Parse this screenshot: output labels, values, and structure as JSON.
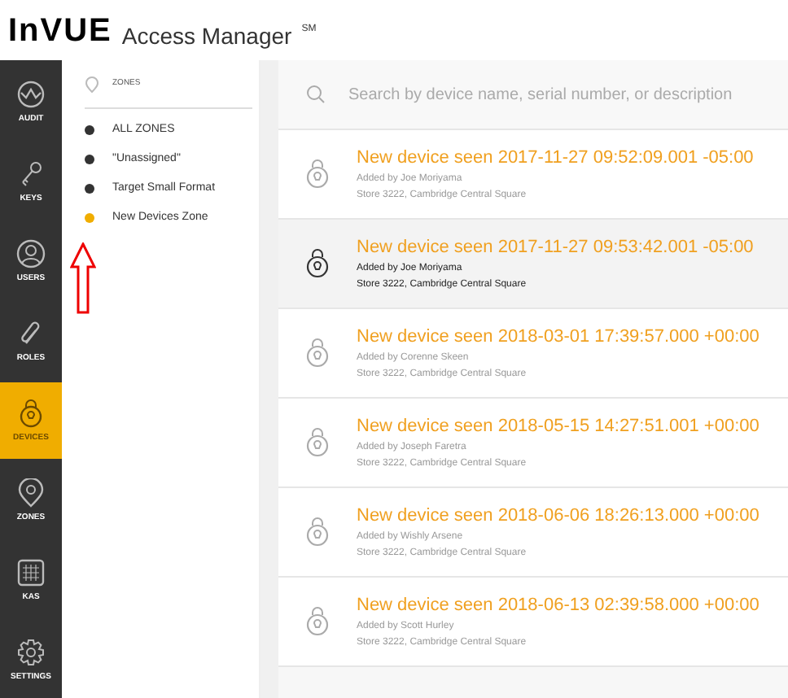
{
  "header": {
    "logo": "InVUE",
    "title": "Access Manager",
    "mark": "SM"
  },
  "nav": [
    {
      "label": "AUDIT",
      "selected": false
    },
    {
      "label": "KEYS",
      "selected": false
    },
    {
      "label": "USERS",
      "selected": false
    },
    {
      "label": "ROLES",
      "selected": false
    },
    {
      "label": "DEVICES",
      "selected": true
    },
    {
      "label": "ZONES",
      "selected": false
    },
    {
      "label": "KAS",
      "selected": false
    },
    {
      "label": "SETTINGS",
      "selected": false
    }
  ],
  "zones": {
    "title": "ZONES",
    "items": [
      {
        "label": "ALL ZONES",
        "color": "#333333"
      },
      {
        "label": "\"Unassigned\"",
        "color": "#333333"
      },
      {
        "label": "Target Small Format",
        "color": "#333333"
      },
      {
        "label": "New Devices Zone",
        "color": "#f0ad00"
      }
    ]
  },
  "search": {
    "placeholder": "Search by device name, serial number, or description"
  },
  "devices": [
    {
      "title": "New device seen 2017-11-27 09:52:09.001 -05:00",
      "added_by": "Added by Joe Moriyama",
      "location": "Store 3222, Cambridge Central Square",
      "selected": false
    },
    {
      "title": "New device seen 2017-11-27 09:53:42.001 -05:00",
      "added_by": "Added by Joe Moriyama",
      "location": "Store 3222, Cambridge Central Square",
      "selected": true
    },
    {
      "title": "New device seen 2018-03-01 17:39:57.000 +00:00",
      "added_by": "Added by Corenne Skeen",
      "location": "Store 3222, Cambridge Central Square",
      "selected": false
    },
    {
      "title": "New device seen 2018-05-15 14:27:51.001 +00:00",
      "added_by": "Added by Joseph Faretra",
      "location": "Store 3222, Cambridge Central Square",
      "selected": false
    },
    {
      "title": "New device seen 2018-06-06 18:26:13.000 +00:00",
      "added_by": "Added by Wishly Arsene",
      "location": "Store 3222, Cambridge Central Square",
      "selected": false
    },
    {
      "title": "New device seen 2018-06-13 02:39:58.000 +00:00",
      "added_by": "Added by Scott Hurley",
      "location": "Store 3222, Cambridge Central Square",
      "selected": false
    }
  ]
}
